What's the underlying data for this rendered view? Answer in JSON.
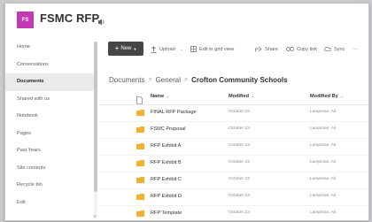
{
  "site": {
    "logo_text": "FS",
    "title": "FSMC RFP",
    "logo_color": "#c239b3"
  },
  "nav": {
    "items": [
      {
        "label": "Home",
        "active": false
      },
      {
        "label": "Conversations",
        "active": false
      },
      {
        "label": "Documents",
        "active": true
      },
      {
        "label": "Shared with us",
        "active": false
      },
      {
        "label": "Notebook",
        "active": false
      },
      {
        "label": "Pages",
        "active": false
      },
      {
        "label": "Past Years",
        "active": false
      },
      {
        "label": "Site contents",
        "active": false
      },
      {
        "label": "Recycle bin",
        "active": false
      },
      {
        "label": "Edit",
        "active": false
      }
    ]
  },
  "command_bar": {
    "new_label": "New",
    "upload_label": "Upload",
    "grid_label": "Edit in grid view",
    "share_label": "Share",
    "copy_link_label": "Copy link",
    "sync_label": "Sync",
    "more_label": "···"
  },
  "breadcrumb": {
    "items": [
      "Documents",
      "General"
    ],
    "current": "Crofton Community Schools",
    "separator": ">"
  },
  "list": {
    "columns": {
      "name": "Name",
      "modified": "Modified",
      "modified_by": "Modified By"
    },
    "rows": [
      {
        "name": "FINAL RFP Package",
        "modified": "October 23",
        "modified_by": "Lampman, Ali"
      },
      {
        "name": "FSMC Proposal",
        "modified": "October 23",
        "modified_by": "Lampman, Ali"
      },
      {
        "name": "RFP Exhibit A",
        "modified": "October 23",
        "modified_by": "Lampman, Ali"
      },
      {
        "name": "RFP Exhibit B",
        "modified": "October 23",
        "modified_by": "Lampman, Ali"
      },
      {
        "name": "RFP Exhibit C",
        "modified": "October 23",
        "modified_by": "Lampman, Ali"
      },
      {
        "name": "RFP Exhibit D",
        "modified": "October 23",
        "modified_by": "Lampman, Ali"
      },
      {
        "name": "RFP Template",
        "modified": "October 23",
        "modified_by": "Lampman, Ali"
      }
    ]
  },
  "colors": {
    "folder": "#f2b12e",
    "new_button": "#484644",
    "active_nav_bg": "#edebe9"
  }
}
